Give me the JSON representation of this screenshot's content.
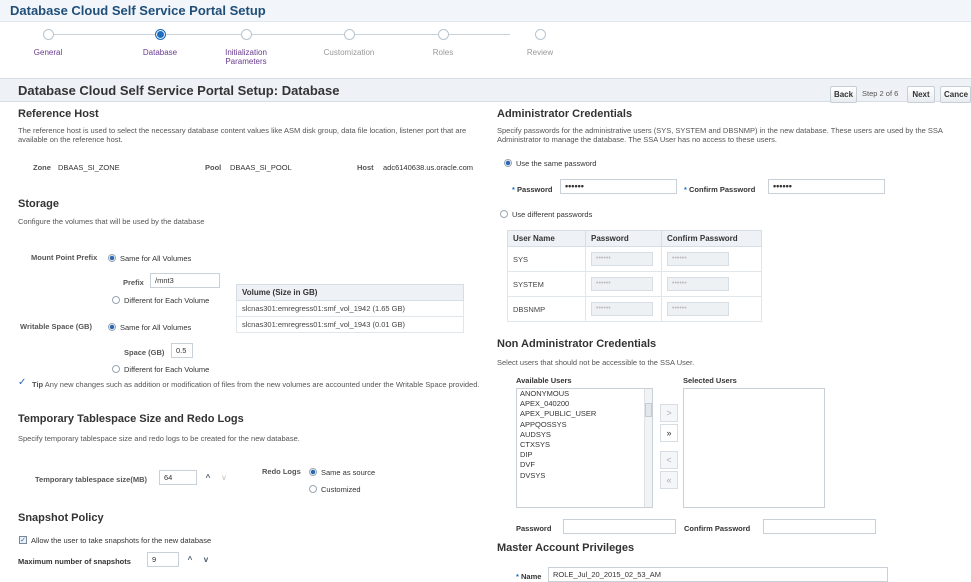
{
  "app": {
    "title": "Database Cloud Self Service Portal Setup"
  },
  "train": {
    "steps": [
      {
        "label": "General"
      },
      {
        "label": "Database"
      },
      {
        "label": "Initialization Parameters"
      },
      {
        "label": "Customization"
      },
      {
        "label": "Roles"
      },
      {
        "label": "Review"
      }
    ],
    "current_index": 1
  },
  "header": {
    "title": "Database Cloud Self Service Portal Setup: Database",
    "back_label": "Back",
    "step_text": "Step 2 of 6",
    "next_label": "Next",
    "cancel_label": "Cance"
  },
  "reference_host": {
    "title": "Reference Host",
    "desc": "The reference host is used to select the necessary database content values like ASM disk group, data file location, listener port that are available on the reference host.",
    "zone_label": "Zone",
    "zone_value": "DBAAS_SI_ZONE",
    "pool_label": "Pool",
    "pool_value": "DBAAS_SI_POOL",
    "host_label": "Host",
    "host_value": "adc6140638.us.oracle.com"
  },
  "storage": {
    "title": "Storage",
    "desc": "Configure the volumes that will be used by the database",
    "mount_label": "Mount Point Prefix",
    "same_all": "Same for All Volumes",
    "prefix_label": "Prefix",
    "prefix_value": "/mnt3",
    "different_each": "Different for Each Volume",
    "writable_label": "Writable Space (GB)",
    "writable_same": "Same for All Volumes",
    "space_label": "Space (GB)",
    "space_value": "0.5",
    "writable_different": "Different for Each Volume",
    "volume_header": "Volume (Size in GB)",
    "volumes": [
      "slcnas301:emregress01:smf_vol_1942 (1.65 GB)",
      "slcnas301:emregress01:smf_vol_1943 (0.01 GB)"
    ],
    "tip_label": "Tip",
    "tip_text": "Any new changes such as addition or modification of files from the new volumes are accounted under the Writable Space provided."
  },
  "temp_tablespace": {
    "title": "Temporary Tablespace Size and Redo Logs",
    "desc": "Specify temporary tablespace size and redo logs to be created for the new database.",
    "size_label": "Temporary tablespace size(MB)",
    "size_value": "64",
    "redo_label": "Redo Logs",
    "redo_same": "Same as source",
    "redo_custom": "Customized"
  },
  "snapshot": {
    "title": "Snapshot Policy",
    "allow_label": "Allow the user to take snapshots for the new database",
    "max_label": "Maximum number of snapshots",
    "max_value": "9"
  },
  "admin_credentials": {
    "title": "Administrator Credentials",
    "desc": "Specify passwords for the administrative users (SYS, SYSTEM and DBSNMP) in the new database. These users are used by the SSA Administrator to manage the database. The SSA User has no access to these users.",
    "same_password": "Use the same password",
    "password_label": "Password",
    "password_value": "••••••",
    "confirm_label": "Confirm Password",
    "confirm_value": "••••••",
    "different_passwords": "Use different passwords",
    "columns": [
      "User Name",
      "Password",
      "Confirm Password"
    ],
    "rows": [
      {
        "user": "SYS",
        "pw": "••••••",
        "cpw": "••••••"
      },
      {
        "user": "SYSTEM",
        "pw": "••••••",
        "cpw": "••••••"
      },
      {
        "user": "DBSNMP",
        "pw": "••••••",
        "cpw": "••••••"
      }
    ]
  },
  "non_admin": {
    "title": "Non Administrator Credentials",
    "desc": "Select users that should not be accessible to the SSA User.",
    "available_label": "Available Users",
    "selected_label": "Selected Users",
    "available": [
      "ANONYMOUS",
      "APEX_040200",
      "APEX_PUBLIC_USER",
      "APPQOSSYS",
      "AUDSYS",
      "CTXSYS",
      "DIP",
      "DVF",
      "DVSYS"
    ],
    "password_label": "Password",
    "confirm_label": "Confirm Password"
  },
  "master_account": {
    "title": "Master Account Privileges",
    "name_label": "Name",
    "name_value": "ROLE_Jul_20_2015_02_53_AM"
  },
  "icons": {
    "move": ">",
    "move_all": "»",
    "remove": "<",
    "remove_all": "«",
    "check": "✓",
    "up": "^",
    "down": "v"
  }
}
